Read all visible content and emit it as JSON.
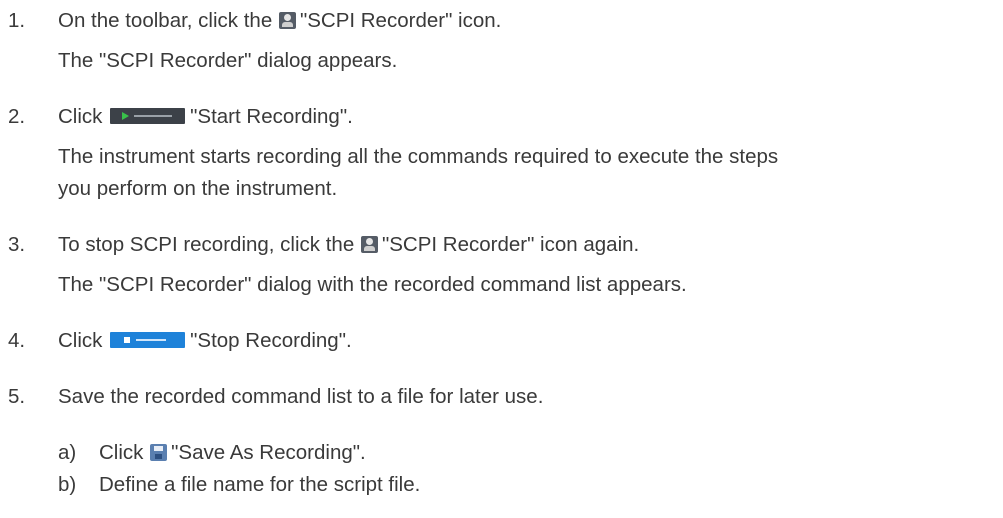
{
  "steps": [
    {
      "number": "1.",
      "pre": "On the toolbar, click the",
      "post": "\"SCPI Recorder\" icon.",
      "icon": "scpi-recorder-icon",
      "result": "The \"SCPI Recorder\" dialog appears."
    },
    {
      "number": "2.",
      "pre": "Click",
      "post": "\"Start Recording\".",
      "icon": "start-recording-button",
      "result_line1": "The instrument starts recording all the commands required to execute the steps",
      "result_line2": "you perform on the instrument."
    },
    {
      "number": "3.",
      "pre": "To stop SCPI recording, click the",
      "post": "\"SCPI Recorder\" icon again.",
      "icon": "scpi-recorder-icon",
      "result": "The \"SCPI Recorder\" dialog with the recorded command list appears."
    },
    {
      "number": "4.",
      "pre": "Click",
      "post": "\"Stop Recording\".",
      "icon": "stop-recording-button"
    },
    {
      "number": "5.",
      "text": "Save the recorded command list to a file for later use.",
      "substeps": [
        {
          "label": "a)",
          "pre": "Click",
          "post": "\"Save As Recording\".",
          "icon": "save-as-recording-icon"
        },
        {
          "label": "b)",
          "text": "Define a file name for the script file."
        }
      ]
    }
  ]
}
